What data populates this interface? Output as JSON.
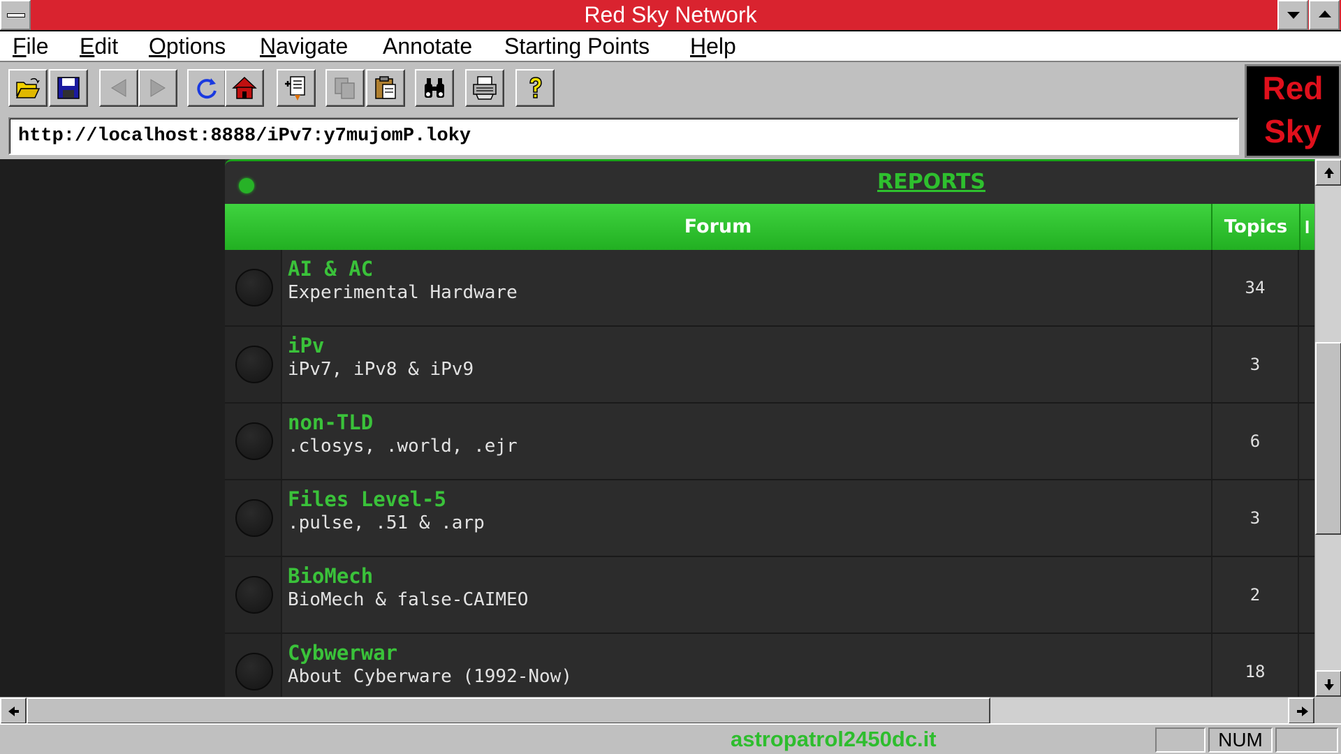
{
  "window": {
    "title": "Red Sky Network"
  },
  "menu": [
    {
      "label": "File",
      "mnemonic": "F",
      "rest": "ile"
    },
    {
      "label": "Edit",
      "mnemonic": "E",
      "rest": "dit"
    },
    {
      "label": "Options",
      "mnemonic": "O",
      "rest": "ptions"
    },
    {
      "label": "Navigate",
      "mnemonic": "N",
      "rest": "avigate"
    },
    {
      "label": "Annotate",
      "mnemonic": "",
      "rest": "Annotate"
    },
    {
      "label": "Starting Points",
      "mnemonic": "",
      "rest": "Starting Points"
    },
    {
      "label": "Help",
      "mnemonic": "H",
      "rest": "elp"
    }
  ],
  "toolbar": {
    "buttons": [
      "open-icon",
      "save-icon",
      "back-icon",
      "forward-icon",
      "reload-icon",
      "home-icon",
      "add-hotlist-icon",
      "copy-icon",
      "paste-icon",
      "find-icon",
      "print-icon",
      "help-icon"
    ]
  },
  "address": {
    "url": "http://localhost:8888/iPv7:y7mujomP.loky"
  },
  "logo": {
    "line1": "Red",
    "line2": "Sky"
  },
  "page": {
    "section_title": "REPORTS",
    "columns": {
      "forum": "Forum",
      "topics": "Topics",
      "more": "I"
    },
    "forums": [
      {
        "name": "AI & AC",
        "description": "Experimental Hardware",
        "topics": "34"
      },
      {
        "name": "iPv",
        "description": "iPv7, iPv8 & iPv9",
        "topics": "3"
      },
      {
        "name": "non-TLD",
        "description": ".closys, .world, .ejr",
        "topics": "6"
      },
      {
        "name": "Files Level-5",
        "description": ".pulse, .51 & .arp",
        "topics": "3"
      },
      {
        "name": "BioMech",
        "description": "BioMech & false-CAIMEO",
        "topics": "2"
      },
      {
        "name": "Cybwerwar",
        "description": "About Cyberware (1992-Now)",
        "topics": "18"
      }
    ]
  },
  "status": {
    "text": "astropatrol2450dc.it",
    "num": "NUM"
  },
  "colors": {
    "titlebar": "#d9232f",
    "accent_green": "#2ec02e",
    "logo_red": "#e0101c"
  }
}
